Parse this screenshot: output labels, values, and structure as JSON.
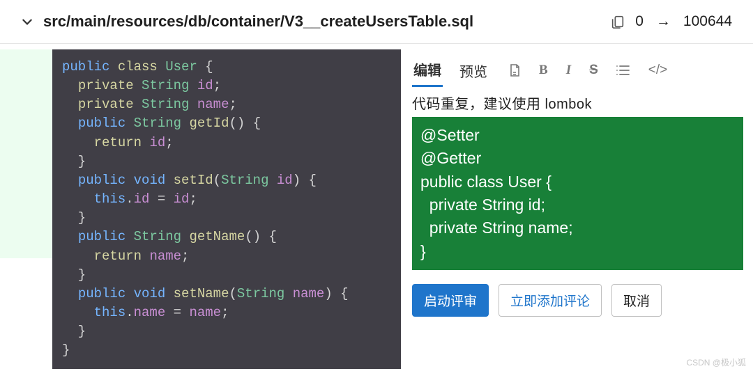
{
  "header": {
    "file_path": "src/main/resources/db/container/V3__createUsersTable.sql",
    "mode_from": "0",
    "mode_to": "100644"
  },
  "code": {
    "lines": [
      [
        {
          "c": "kw-pub",
          "t": "public"
        },
        {
          "c": "punct",
          "t": " "
        },
        {
          "c": "kw-class",
          "t": "class"
        },
        {
          "c": "punct",
          "t": " "
        },
        {
          "c": "classname",
          "t": "User"
        },
        {
          "c": "punct",
          "t": " {"
        }
      ],
      [
        {
          "c": "punct",
          "t": "  "
        },
        {
          "c": "kw-priv",
          "t": "private"
        },
        {
          "c": "punct",
          "t": " "
        },
        {
          "c": "typename",
          "t": "String"
        },
        {
          "c": "punct",
          "t": " "
        },
        {
          "c": "ident",
          "t": "id"
        },
        {
          "c": "punct",
          "t": ";"
        }
      ],
      [
        {
          "c": "punct",
          "t": "  "
        },
        {
          "c": "kw-priv",
          "t": "private"
        },
        {
          "c": "punct",
          "t": " "
        },
        {
          "c": "typename",
          "t": "String"
        },
        {
          "c": "punct",
          "t": " "
        },
        {
          "c": "ident",
          "t": "name"
        },
        {
          "c": "punct",
          "t": ";"
        }
      ],
      [
        {
          "c": "punct",
          "t": "  "
        },
        {
          "c": "kw-pub",
          "t": "public"
        },
        {
          "c": "punct",
          "t": " "
        },
        {
          "c": "typename",
          "t": "String"
        },
        {
          "c": "punct",
          "t": " "
        },
        {
          "c": "method",
          "t": "getId"
        },
        {
          "c": "punct",
          "t": "() {"
        }
      ],
      [
        {
          "c": "punct",
          "t": "    "
        },
        {
          "c": "kw-return",
          "t": "return"
        },
        {
          "c": "punct",
          "t": " "
        },
        {
          "c": "ident",
          "t": "id"
        },
        {
          "c": "punct",
          "t": ";"
        }
      ],
      [
        {
          "c": "punct",
          "t": "  }"
        }
      ],
      [
        {
          "c": "punct",
          "t": "  "
        },
        {
          "c": "kw-pub",
          "t": "public"
        },
        {
          "c": "punct",
          "t": " "
        },
        {
          "c": "kw-void",
          "t": "void"
        },
        {
          "c": "punct",
          "t": " "
        },
        {
          "c": "method",
          "t": "setId"
        },
        {
          "c": "punct",
          "t": "("
        },
        {
          "c": "typename",
          "t": "String"
        },
        {
          "c": "punct",
          "t": " "
        },
        {
          "c": "param",
          "t": "id"
        },
        {
          "c": "punct",
          "t": ") {"
        }
      ],
      [
        {
          "c": "punct",
          "t": "    "
        },
        {
          "c": "kw-this",
          "t": "this"
        },
        {
          "c": "punct",
          "t": "."
        },
        {
          "c": "ident",
          "t": "id"
        },
        {
          "c": "punct",
          "t": " = "
        },
        {
          "c": "ident",
          "t": "id"
        },
        {
          "c": "punct",
          "t": ";"
        }
      ],
      [
        {
          "c": "punct",
          "t": "  }"
        }
      ],
      [
        {
          "c": "punct",
          "t": "  "
        },
        {
          "c": "kw-pub",
          "t": "public"
        },
        {
          "c": "punct",
          "t": " "
        },
        {
          "c": "typename",
          "t": "String"
        },
        {
          "c": "punct",
          "t": " "
        },
        {
          "c": "method",
          "t": "getName"
        },
        {
          "c": "punct",
          "t": "() {"
        }
      ],
      [
        {
          "c": "punct",
          "t": "    "
        },
        {
          "c": "kw-return",
          "t": "return"
        },
        {
          "c": "punct",
          "t": " "
        },
        {
          "c": "ident",
          "t": "name"
        },
        {
          "c": "punct",
          "t": ";"
        }
      ],
      [
        {
          "c": "punct",
          "t": "  }"
        }
      ],
      [
        {
          "c": "punct",
          "t": "  "
        },
        {
          "c": "kw-pub",
          "t": "public"
        },
        {
          "c": "punct",
          "t": " "
        },
        {
          "c": "kw-void",
          "t": "void"
        },
        {
          "c": "punct",
          "t": " "
        },
        {
          "c": "method",
          "t": "setName"
        },
        {
          "c": "punct",
          "t": "("
        },
        {
          "c": "typename",
          "t": "String"
        },
        {
          "c": "punct",
          "t": " "
        },
        {
          "c": "param",
          "t": "name"
        },
        {
          "c": "punct",
          "t": ") {"
        }
      ],
      [
        {
          "c": "punct",
          "t": "    "
        },
        {
          "c": "kw-this",
          "t": "this"
        },
        {
          "c": "punct",
          "t": "."
        },
        {
          "c": "ident",
          "t": "name"
        },
        {
          "c": "punct",
          "t": " = "
        },
        {
          "c": "ident",
          "t": "name"
        },
        {
          "c": "punct",
          "t": ";"
        }
      ],
      [
        {
          "c": "punct",
          "t": "  }"
        }
      ],
      [
        {
          "c": "punct",
          "t": "}"
        }
      ]
    ]
  },
  "comment": {
    "tab_edit": "编辑",
    "tab_preview": "预览",
    "toolbar_icons": {
      "attach": "attach",
      "bold": "B",
      "italic": "I",
      "strike": "S",
      "list": "list",
      "code": "</>"
    },
    "text": "代码重复，建议使用 lombok",
    "suggestion": "@Setter\n@Getter\npublic class User {\n  private String id;\n  private String name;\n}",
    "actions": {
      "start_review": "启动评审",
      "add_now": "立即添加评论",
      "cancel": "取消"
    }
  },
  "watermark": "CSDN @极小狐"
}
